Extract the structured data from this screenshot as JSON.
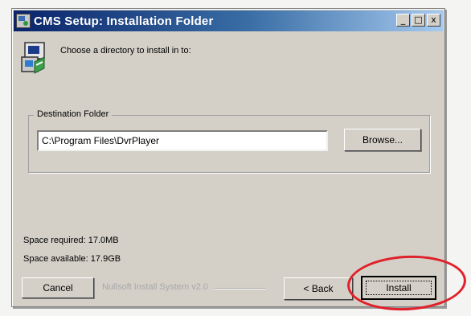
{
  "window": {
    "title": "CMS Setup: Installation Folder",
    "buttons": [
      "_",
      "□",
      "x"
    ]
  },
  "header": {
    "icon": "installer-box-icon",
    "text": "Choose a directory to install in to:"
  },
  "destination": {
    "group_label": "Destination Folder",
    "path_value": "C:\\Program Files\\DvrPlayer",
    "browse_label": "Browse..."
  },
  "space": {
    "required": "Space required: 17.0MB",
    "available": "Space available: 17.9GB"
  },
  "footer": {
    "cancel_label": "Cancel",
    "branding": "Nullsoft Install System v2.0",
    "back_label": "< Back",
    "install_label": "Install"
  },
  "colors": {
    "highlight": "#e0202a",
    "title_start": "#0a246a",
    "title_end": "#a6caf0"
  }
}
